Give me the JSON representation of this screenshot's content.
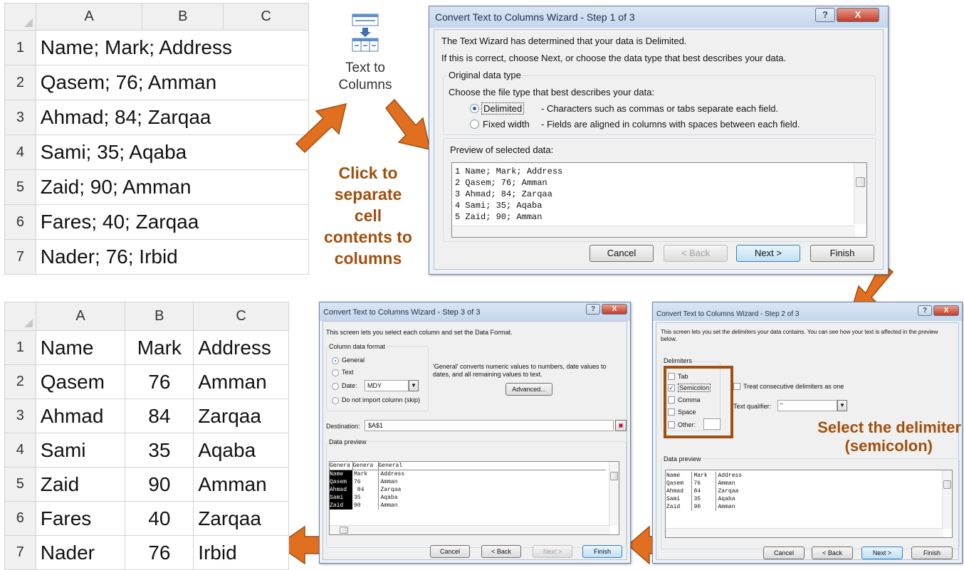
{
  "sheet1": {
    "columns": [
      "A",
      "B",
      "C"
    ],
    "rows": [
      {
        "n": "1",
        "text": "Name; Mark; Address"
      },
      {
        "n": "2",
        "text": "Qasem; 76; Amman"
      },
      {
        "n": "3",
        "text": "Ahmad;  84; Zarqaa"
      },
      {
        "n": "4",
        "text": "Sami; 35; Aqaba"
      },
      {
        "n": "5",
        "text": "Zaid; 90; Amman"
      },
      {
        "n": "6",
        "text": "Fares; 40; Zarqaa"
      },
      {
        "n": "7",
        "text": "Nader; 76; Irbid"
      }
    ]
  },
  "sheet2": {
    "columns": [
      "A",
      "B",
      "C"
    ],
    "rows": [
      {
        "n": "1",
        "a": "Name",
        "b": "Mark",
        "c": "Address"
      },
      {
        "n": "2",
        "a": "Qasem",
        "b": "76",
        "c": "Amman"
      },
      {
        "n": "3",
        "a": "Ahmad",
        "b": "84",
        "c": "Zarqaa"
      },
      {
        "n": "4",
        "a": "Sami",
        "b": "35",
        "c": "Aqaba"
      },
      {
        "n": "5",
        "a": "Zaid",
        "b": "90",
        "c": "Amman"
      },
      {
        "n": "6",
        "a": "Fares",
        "b": "40",
        "c": "Zarqaa"
      },
      {
        "n": "7",
        "a": "Nader",
        "b": "76",
        "c": "Irbid"
      }
    ]
  },
  "ribbon_button": {
    "line1": "Text to",
    "line2": "Columns",
    "icon": "text-to-columns-icon"
  },
  "callout_click": [
    "Click to",
    "separate",
    "cell",
    "contents to",
    "columns"
  ],
  "callout_select": [
    "Select the delimiter",
    "(semicolon)"
  ],
  "accent_color": "#e07020",
  "callout_color": "#a0500e",
  "step1": {
    "title": "Convert Text to Columns Wizard - Step 1 of 3",
    "help": "?",
    "close": "X",
    "intro1": "The Text Wizard has determined that your data is Delimited.",
    "intro2": "If this is correct, choose Next, or choose the data type that best describes your data.",
    "group_label": "Original data type",
    "choose_label": "Choose the file type that best describes your data:",
    "opt_delimited": "Delimited",
    "opt_delimited_desc": "- Characters such as commas or tabs separate each field.",
    "opt_fixed": "Fixed width",
    "opt_fixed_desc": "- Fields are aligned in columns with spaces between each field.",
    "preview_label": "Preview of selected data:",
    "preview_lines": [
      "1 Name; Mark; Address",
      "2 Qasem; 76; Amman",
      "3 Ahmad;  84; Zarqaa",
      "4 Sami; 35; Aqaba",
      "5 Zaid; 90; Amman"
    ],
    "btn_cancel": "Cancel",
    "btn_back": "< Back",
    "btn_next": "Next >",
    "btn_finish": "Finish"
  },
  "step2": {
    "title": "Convert Text to Columns Wizard - Step 2 of 3",
    "help": "?",
    "close": "X",
    "intro": "This screen lets you set the delimiters your data contains.  You can see how your text is affected in the preview below.",
    "delimiters_label": "Delimiters",
    "delims": [
      {
        "label": "Tab",
        "checked": false
      },
      {
        "label": "Semicolon",
        "checked": true
      },
      {
        "label": "Comma",
        "checked": false
      },
      {
        "label": "Space",
        "checked": false
      },
      {
        "label": "Other:",
        "checked": false
      }
    ],
    "treat_consecutive": "Treat consecutive delimiters as one",
    "text_qualifier_label": "Text qualifier:",
    "text_qualifier_value": "\"",
    "data_preview_label": "Data preview",
    "preview_rows": [
      [
        "Name",
        "Mark",
        "Address"
      ],
      [
        "Qasem",
        "76",
        "Amman"
      ],
      [
        "Ahmad",
        "84",
        "Zarqaa"
      ],
      [
        "Sami",
        "35",
        "Aqaba"
      ],
      [
        "Zaid",
        "90",
        "Amman"
      ]
    ],
    "btn_cancel": "Cancel",
    "btn_back": "< Back",
    "btn_next": "Next >",
    "btn_finish": "Finish"
  },
  "step3": {
    "title": "Convert Text to Columns Wizard - Step 3 of 3",
    "help": "?",
    "close": "X",
    "intro": "This screen lets you select each column and set the Data Format.",
    "format_label": "Column data format",
    "opt_general": "General",
    "opt_text": "Text",
    "opt_date": "Date:",
    "date_value": "MDY",
    "opt_skip": "Do not import column (skip)",
    "general_note": "'General' converts numeric values to numbers, date values to dates, and all remaining values to text.",
    "advanced_btn": "Advanced...",
    "destination_label": "Destination:",
    "destination_value": "$A$1",
    "data_preview_label": "Data preview",
    "preview_header": [
      "Genera",
      "Genera",
      "General"
    ],
    "preview_rows": [
      [
        "Name",
        "Mark",
        "Address"
      ],
      [
        "Qasem",
        "76",
        "Amman"
      ],
      [
        "Ahmad",
        " 84",
        "Zarqaa"
      ],
      [
        "Sami",
        "35",
        "Aqaba"
      ],
      [
        "Zaid",
        "90",
        "Amman"
      ]
    ],
    "btn_cancel": "Cancel",
    "btn_back": "< Back",
    "btn_next": "Next >",
    "btn_finish": "Finish"
  }
}
